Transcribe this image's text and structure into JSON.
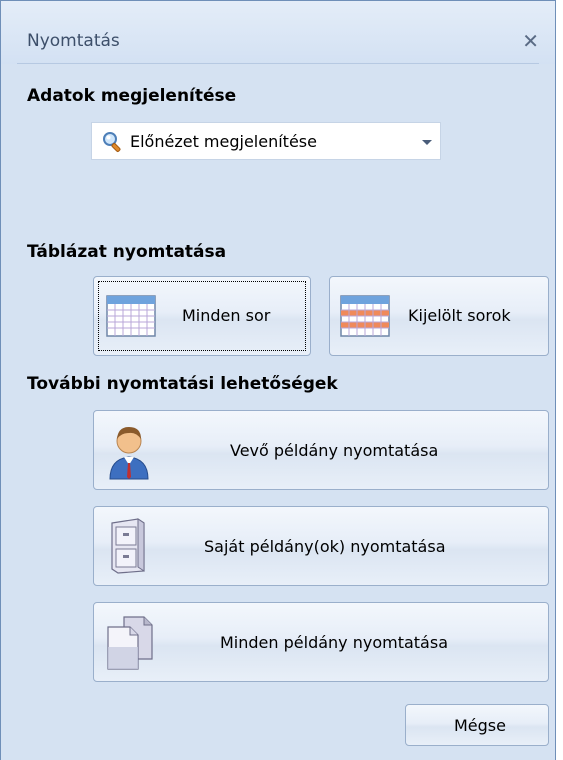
{
  "window": {
    "title": "Nyomtatás"
  },
  "icons": {
    "close": "close-icon",
    "preview": "magnifier-icon",
    "all_rows": "table-grid-icon",
    "selected_rows": "table-highlight-icon",
    "customer_copy": "user-icon",
    "own_copies": "filing-cabinet-icon",
    "all_copies": "documents-icon"
  },
  "display_section": {
    "heading": "Adatok megjelenítése",
    "combo_value": "Előnézet megjelenítése"
  },
  "table_section": {
    "heading": "Táblázat nyomtatása",
    "all_rows_label": "Minden sor",
    "selected_rows_label": "Kijelölt sorok"
  },
  "more_section": {
    "heading": "További nyomtatási lehetőségek",
    "customer_copy_label": "Vevő példány nyomtatása",
    "own_copies_label": "Saját példány(ok) nyomtatása",
    "all_copies_label": "Minden példány nyomtatása"
  },
  "footer": {
    "cancel_label": "Mégse"
  },
  "colors": {
    "panel_bg": "#d5e2f2",
    "button_border": "#9aafcb",
    "title_text": "#3d4f6a"
  }
}
